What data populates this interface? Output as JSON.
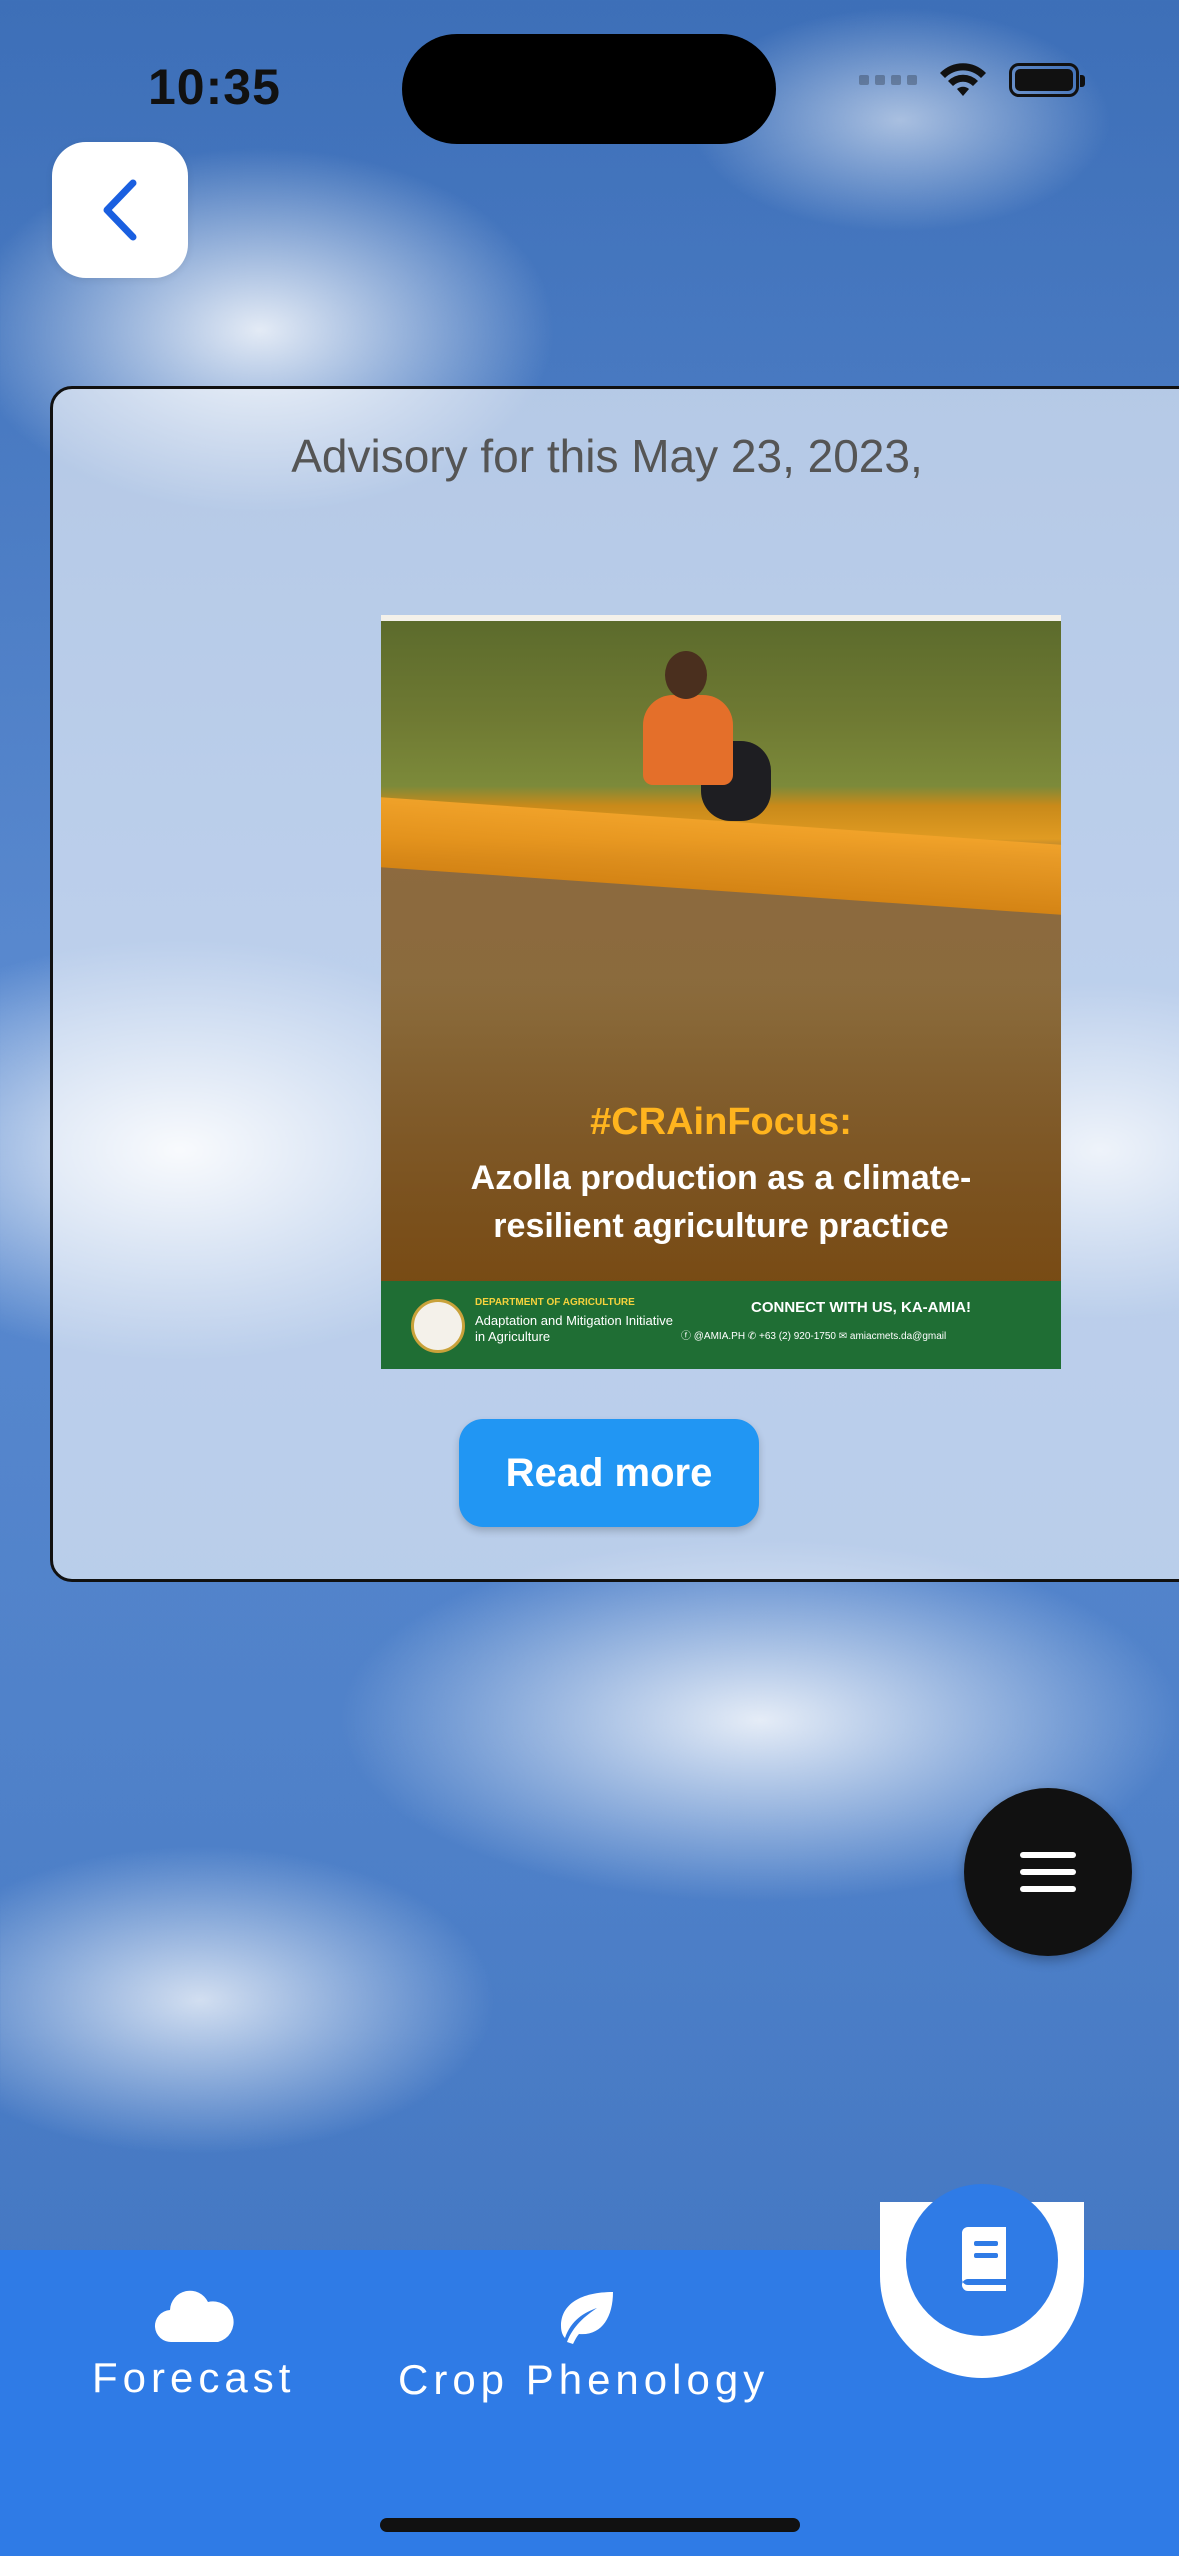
{
  "status_bar": {
    "time": "10:35"
  },
  "advisory": {
    "title": "Advisory for this May 23, 2023,",
    "image": {
      "hashtag": "#CRAinFocus:",
      "headline_line1": "Azolla production as a climate-",
      "headline_line2": "resilient agriculture practice",
      "department": "DEPARTMENT OF AGRICULTURE",
      "org_name": "Adaptation and Mitigation Initiative in Agriculture",
      "connect": "CONNECT WITH US, KA-AMIA!",
      "contacts": "ⓕ @AMIA.PH  ✆ +63 (2) 920-1750  ✉ amiacmets.da@gmail"
    },
    "read_more_label": "Read more"
  },
  "bottom_nav": {
    "items": [
      {
        "label": "Forecast",
        "icon": "cloud-icon"
      },
      {
        "label": "Crop Phenology",
        "icon": "leaf-icon"
      }
    ],
    "center_icon": "book-icon"
  },
  "colors": {
    "nav_blue": "#2f7be6",
    "button_blue": "#2196f3",
    "fab_black": "#111111"
  }
}
